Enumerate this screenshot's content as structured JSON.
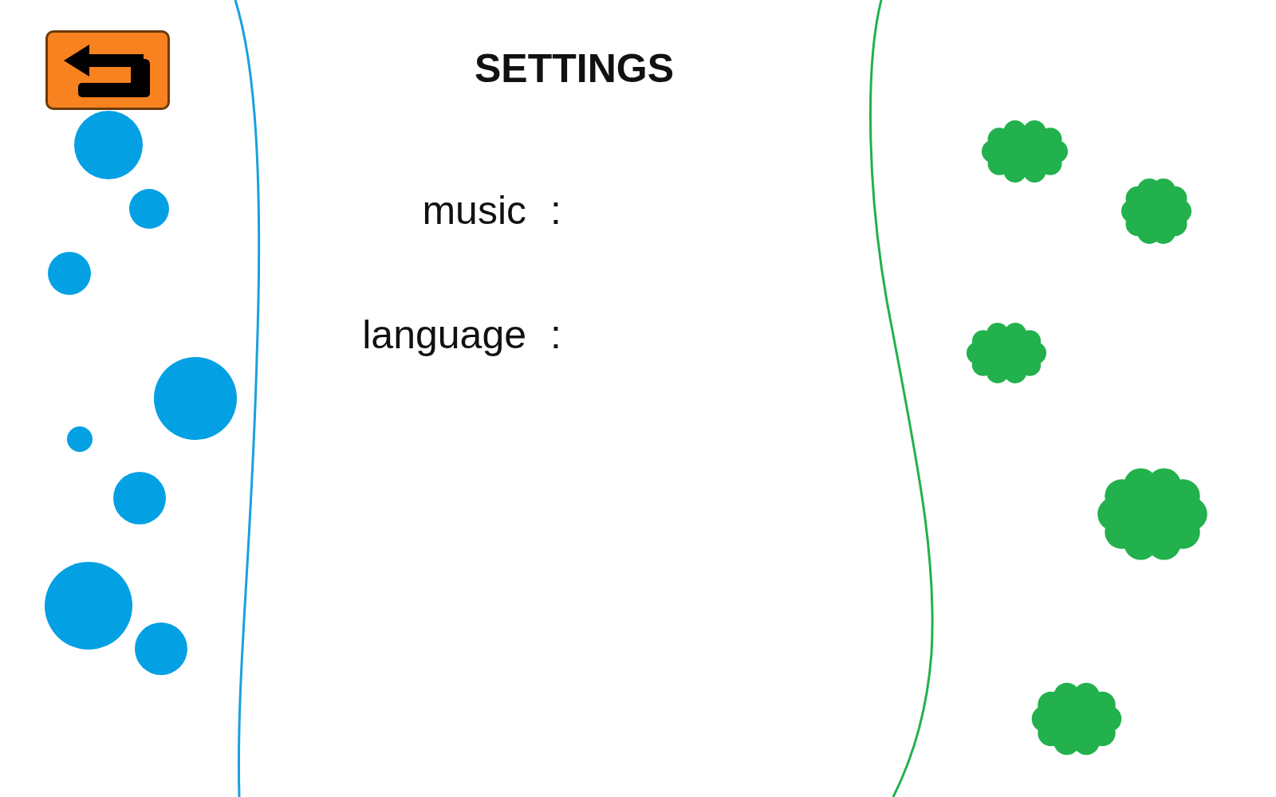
{
  "screen": {
    "title": "SETTINGS"
  },
  "back_button": {
    "label": ""
  },
  "settings": [
    {
      "label": "music",
      "separator": ":"
    },
    {
      "label": "language",
      "separator": ":"
    }
  ]
}
